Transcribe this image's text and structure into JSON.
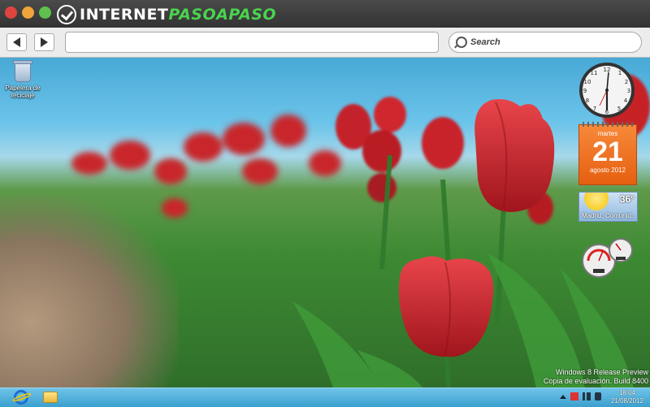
{
  "browser": {
    "brand_prefix": "INTERNET",
    "brand_accent": "PASOAPASO",
    "url_value": "",
    "search_placeholder": "Search"
  },
  "desktop": {
    "recycle_bin_label": "Papelera de reciclaje",
    "calendar": {
      "day_name": "martes",
      "day_number": "21",
      "month_year": "agosto 2012"
    },
    "weather": {
      "temperature": "36°",
      "city": "Madrid, Comunid..."
    },
    "watermark_line1": "Windows 8 Release Preview",
    "watermark_line2": "Copia de evaluación. Build 8400"
  },
  "taskbar": {
    "time": "18:04",
    "date": "21/08/2012"
  },
  "colors": {
    "titlebar": "#333333",
    "brand_accent": "#4ad34f",
    "calendar_orange": "#e65f10",
    "taskbar_blue": "#3aa0cf"
  },
  "icons": [
    "close-icon",
    "minimize-icon",
    "maximize-icon",
    "back-arrow-icon",
    "forward-arrow-icon",
    "search-icon",
    "recycle-bin-icon",
    "ie-icon",
    "folder-icon",
    "flag-icon",
    "network-icon",
    "volume-icon"
  ]
}
